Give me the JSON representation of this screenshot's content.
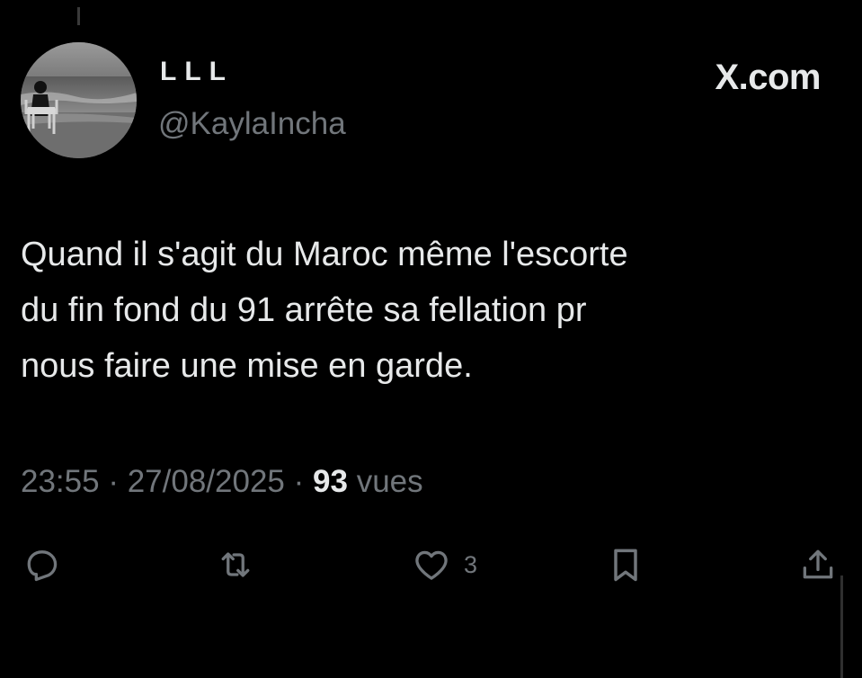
{
  "tweet": {
    "display_name": "LLL",
    "handle": "@KaylaIncha",
    "brand": "X.com",
    "text_lines": [
      "Quand il s'agit du Maroc même l'escorte",
      "du fin fond du 91 arrête sa fellation pr",
      "nous faire une mise en garde."
    ],
    "time": "23:55",
    "separator": "·",
    "date": "27/08/2025",
    "views_count": "93",
    "views_label": "vues"
  },
  "actions": {
    "reply_icon": "reply-icon",
    "retweet_icon": "retweet-icon",
    "like_icon": "heart-icon",
    "like_count": "3",
    "bookmark_icon": "bookmark-icon",
    "share_icon": "share-icon"
  },
  "colors": {
    "background": "#000000",
    "primary_text": "#e7e9ea",
    "secondary_text": "#71767b"
  }
}
